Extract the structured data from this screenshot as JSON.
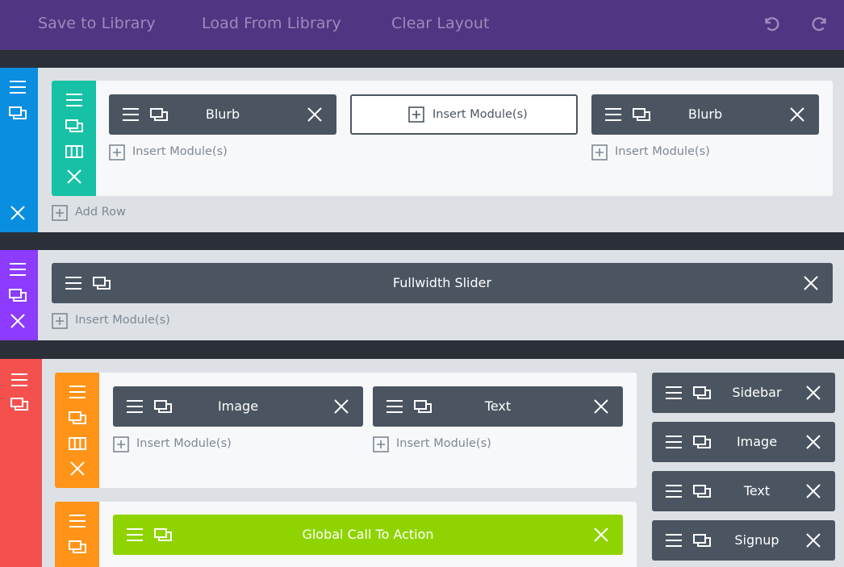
{
  "toolbar": {
    "save_label": "Save to Library",
    "load_label": "Load From Library",
    "clear_label": "Clear Layout",
    "undo_icon": "undo-icon",
    "redo_icon": "redo-icon"
  },
  "colors": {
    "toolbar_bg": "#503582",
    "section_blue": "#0a8ee0",
    "section_purple": "#8d3bff",
    "section_red": "#f4514e",
    "row_teal": "#17c1a5",
    "row_orange": "#ff9418",
    "module_dark": "#4a5561",
    "module_lime": "#8fd400"
  },
  "sections": [
    {
      "rows": [
        {
          "columns": [
            {
              "module": "Blurb",
              "insert": "Insert Module(s)"
            },
            {
              "insert_button": "Insert Module(s)"
            },
            {
              "module": "Blurb",
              "insert": "Insert Module(s)"
            }
          ]
        }
      ],
      "add_row": "Add Row"
    },
    {
      "fullwidth_module": "Fullwidth Slider",
      "insert": "Insert Module(s)"
    },
    {
      "rows": [
        {
          "columns": [
            {
              "module": "Image",
              "insert": "Insert Module(s)"
            },
            {
              "module": "Text",
              "insert": "Insert Module(s)"
            }
          ]
        },
        {
          "columns": [
            {
              "module": "Global Call To Action"
            }
          ]
        }
      ],
      "sidebar_modules": [
        "Sidebar",
        "Image",
        "Text",
        "Signup"
      ]
    }
  ]
}
